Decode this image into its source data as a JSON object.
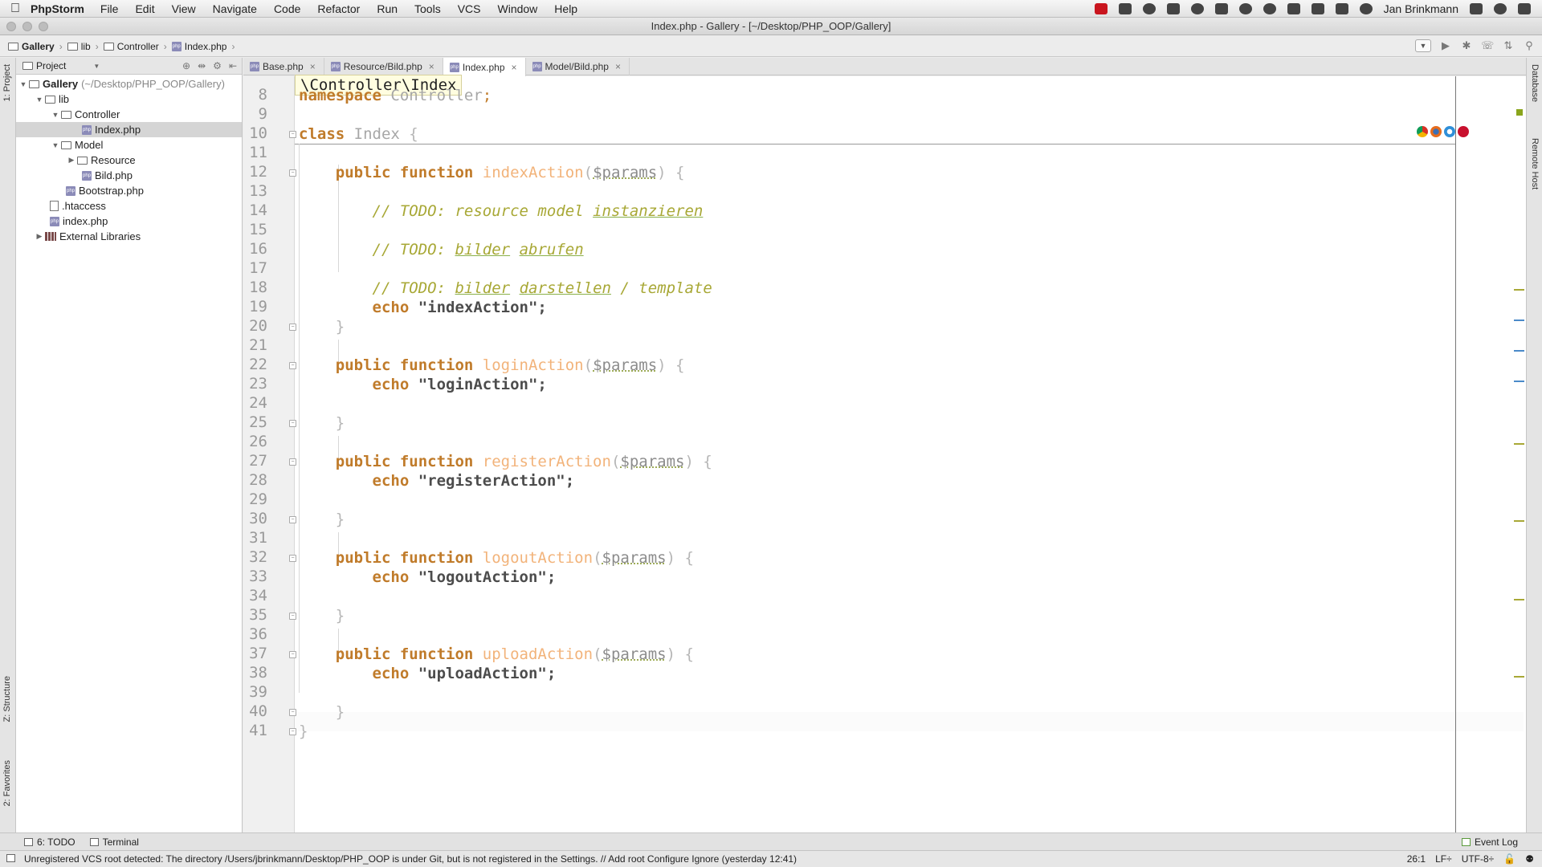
{
  "menubar": {
    "app": "PhpStorm",
    "items": [
      "File",
      "Edit",
      "View",
      "Navigate",
      "Code",
      "Refactor",
      "Run",
      "Tools",
      "VCS",
      "Window",
      "Help"
    ],
    "user": "Jan Brinkmann"
  },
  "window": {
    "title": "Index.php - Gallery - [~/Desktop/PHP_OOP/Gallery]"
  },
  "navbar": {
    "crumbs": [
      "Gallery",
      "lib",
      "Controller",
      "Index.php"
    ]
  },
  "project_panel": {
    "header": "Project",
    "tree": [
      {
        "label": "Gallery",
        "suffix": "(~/Desktop/PHP_OOP/Gallery)"
      },
      {
        "label": "lib"
      },
      {
        "label": "Controller"
      },
      {
        "label": "Index.php"
      },
      {
        "label": "Model"
      },
      {
        "label": "Resource"
      },
      {
        "label": "Bild.php"
      },
      {
        "label": "Bootstrap.php"
      },
      {
        "label": ".htaccess"
      },
      {
        "label": "index.php"
      },
      {
        "label": "External Libraries"
      }
    ]
  },
  "left_strip": {
    "project": "1: Project",
    "structure": "Z: Structure",
    "favorites": "2: Favorites"
  },
  "right_strip": {
    "database": "Database",
    "remote": "Remote Host"
  },
  "tabs": [
    {
      "label": "Base.php"
    },
    {
      "label": "Resource/Bild.php"
    },
    {
      "label": "Index.php"
    },
    {
      "label": "Model/Bild.php"
    }
  ],
  "editor": {
    "popup": "\\Controller\\Index",
    "line_numbers": [
      "8",
      "9",
      "10",
      "11",
      "12",
      "13",
      "14",
      "15",
      "16",
      "17",
      "18",
      "19",
      "20",
      "21",
      "22",
      "23",
      "24",
      "25",
      "26",
      "27",
      "28",
      "29",
      "30",
      "31",
      "32",
      "33",
      "34",
      "35",
      "36",
      "37",
      "38",
      "39",
      "40",
      "41"
    ],
    "code": {
      "l8_kw": "namespace ",
      "l8_name": "Controller",
      "l8_end": ";",
      "l10_kw": "class ",
      "l10_name": "Index",
      "l10_brace": " {",
      "l12_kw": "    public function ",
      "l12_fn": "indexAction",
      "l12_open": "(",
      "l12_var": "$params",
      "l12_close": ") {",
      "l14_a": "        // TODO: resource ",
      "l14_b": "model",
      "l14_c": " ",
      "l14_d": "instanzieren",
      "l16_a": "        // TODO: ",
      "l16_b": "bilder",
      "l16_c": " ",
      "l16_d": "abrufen",
      "l18_a": "        // TODO: ",
      "l18_b": "bilder",
      "l18_c": " ",
      "l18_d": "darstellen",
      "l18_e": " / template",
      "l19_echo": "        echo ",
      "l19_str": "\"indexAction\";",
      "l20": "    }",
      "l22_kw": "    public function ",
      "l22_fn": "loginAction",
      "l22_open": "(",
      "l22_var": "$params",
      "l22_close": ") {",
      "l23_echo": "        echo ",
      "l23_str": "\"loginAction\";",
      "l25": "    }",
      "l27_kw": "    public function ",
      "l27_fn": "registerAction",
      "l27_open": "(",
      "l27_var": "$params",
      "l27_close": ") {",
      "l28_echo": "        echo ",
      "l28_str": "\"registerAction\";",
      "l30": "    }",
      "l32_kw": "    public function ",
      "l32_fn": "logoutAction",
      "l32_open": "(",
      "l32_var": "$params",
      "l32_close": ") {",
      "l33_echo": "        echo ",
      "l33_str": "\"logoutAction\";",
      "l35": "    }",
      "l37_kw": "    public function ",
      "l37_fn": "uploadAction",
      "l37_open": "(",
      "l37_var": "$params",
      "l37_close": ") {",
      "l38_echo": "        echo ",
      "l38_str": "\"uploadAction\";",
      "l40": "    }",
      "l41": "}"
    }
  },
  "bottombar": {
    "todo": "6: TODO",
    "terminal": "Terminal",
    "event_log": "Event Log"
  },
  "statusbar": {
    "message": "Unregistered VCS root detected: The directory /Users/jbrinkmann/Desktop/PHP_OOP is under Git, but is not registered in the Settings. // Add root  Configure  Ignore (yesterday 12:41)",
    "position": "26:1",
    "line_sep": "LF÷",
    "encoding": "UTF-8÷"
  },
  "colors": {
    "keyword": "#c07b2a",
    "function": "#f2b37a",
    "todo": "#a8a836",
    "accent_marker_green": "#8ab14a",
    "accent_marker_blue": "#4a8ac9"
  }
}
